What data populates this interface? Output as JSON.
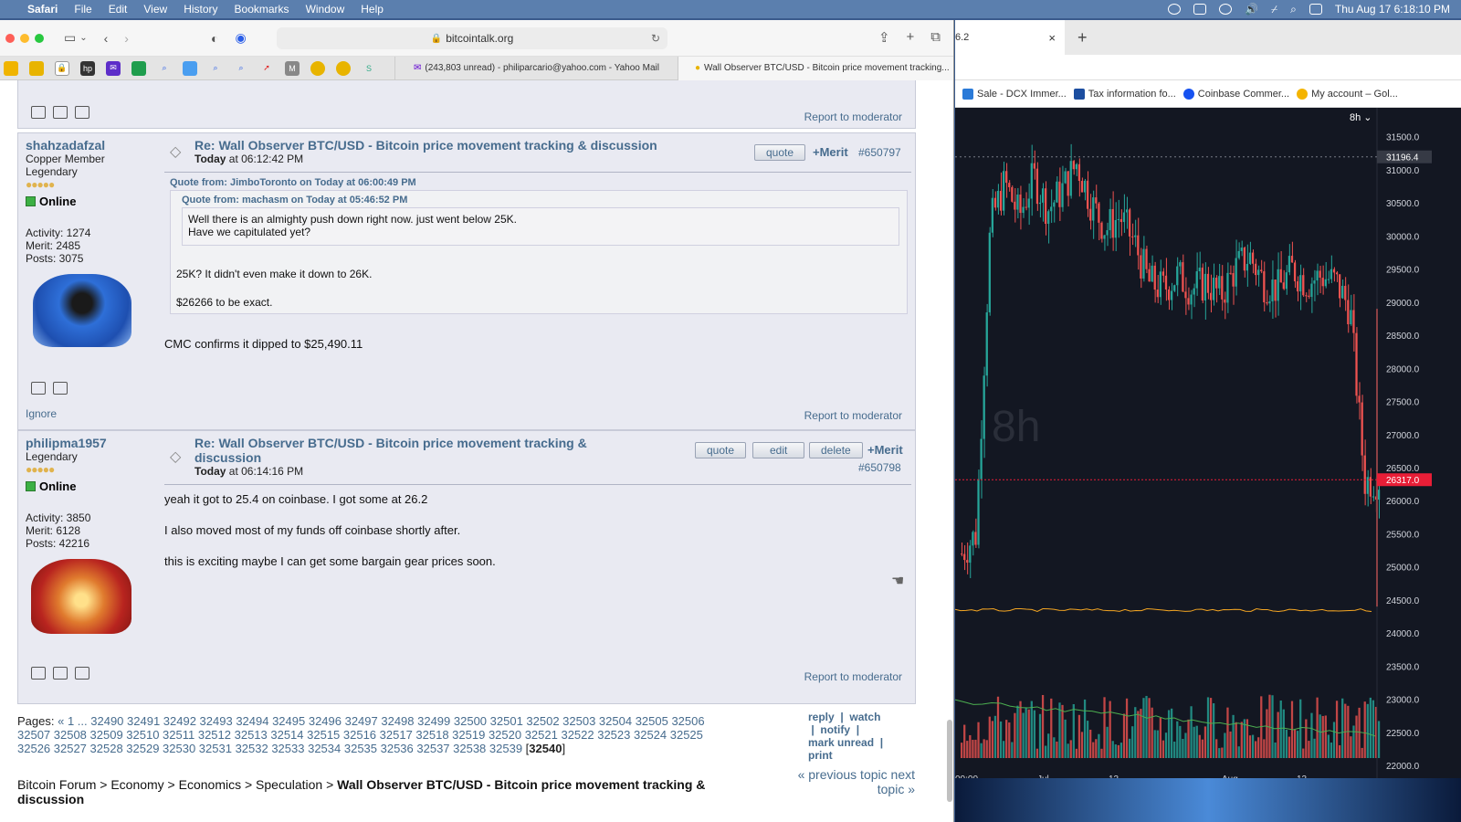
{
  "menubar": {
    "app": "Safari",
    "items": [
      "File",
      "Edit",
      "View",
      "History",
      "Bookmarks",
      "Window",
      "Help"
    ],
    "clock": "Thu Aug 17  6:18:10 PM"
  },
  "safari": {
    "url": "bitcointalk.org",
    "tabs": [
      {
        "title": "(243,803 unread) - philiparcario@yahoo.com - Yahoo Mail"
      },
      {
        "title": "Wall Observer BTC/USD - Bitcoin price movement tracking..."
      }
    ]
  },
  "chart_window": {
    "tab_title": "6.2",
    "bookmarks": [
      "Sale - DCX Immer...",
      "Tax information fo...",
      "Coinbase Commer...",
      "My account – Gol..."
    ],
    "interval": "8h",
    "watermark": "8h",
    "price_labels": [
      "31500.0",
      "31000.0",
      "30500.0",
      "30000.0",
      "29500.0",
      "29000.0",
      "28500.0",
      "28000.0",
      "27500.0",
      "27000.0",
      "26500.0",
      "26000.0",
      "25500.0",
      "25000.0",
      "24500.0",
      "24000.0",
      "23500.0",
      "23000.0",
      "22500.0",
      "22000.0"
    ],
    "price_top": "31196.4",
    "price_current": "26317.0",
    "time_labels": [
      "00:00",
      "Jul",
      "13",
      "Aug",
      "13"
    ],
    "colors": {
      "up": "#26a69a",
      "down": "#ef5350",
      "bg": "#131722",
      "current": "#e91e37"
    }
  },
  "chart_data": {
    "type": "candlestick",
    "title": "",
    "ylim": [
      22000,
      31800
    ],
    "x_labels": [
      "00:00",
      "Jul",
      "13",
      "Aug",
      "13"
    ],
    "close_path": [
      25200,
      25500,
      30200,
      30800,
      30300,
      30900,
      30400,
      30700,
      31100,
      30500,
      30100,
      30300,
      29900,
      29300,
      29200,
      29400,
      29200,
      29300,
      29100,
      29500,
      29700,
      29300,
      29200,
      29500,
      29300,
      29400,
      29300,
      28900,
      26300,
      26317
    ]
  },
  "forum": {
    "top_report": "Report to moderator",
    "post1": {
      "username": "shahzadafzal",
      "rank": "Copper Member",
      "rank2": "Legendary",
      "status": "Online",
      "activity": "Activity: 1274",
      "merit": "Merit: 2485",
      "posts": "Posts: 3075",
      "title": "Re: Wall Observer BTC/USD - Bitcoin price movement tracking & discussion",
      "time_bold": "Today",
      "time": " at 06:12:42 PM",
      "quote_btn": "quote",
      "merit_btn": "+Merit",
      "msg_id": "#650797",
      "quote1_head": "Quote from: JimboToronto on Today at 06:00:49 PM",
      "quote2_head": "Quote from: machasm on Today at 05:46:52 PM",
      "quote2_line1": "Well there is an almighty push down right now. just went below 25K.",
      "quote2_line2": "Have we capitulated yet?",
      "quote1_line1": "25K?  It didn't even make it down to 26K.",
      "quote1_line2": "$26266 to be exact.",
      "body": "CMC confirms it dipped to $25,490.11",
      "ignore": "Ignore",
      "report": "Report to moderator"
    },
    "post2": {
      "username": "philipma1957",
      "rank": "Legendary",
      "status": "Online",
      "activity": "Activity: 3850",
      "merit": "Merit: 6128",
      "posts": "Posts: 42216",
      "title_line1": "Re: Wall Observer BTC/USD - Bitcoin price movement tracking &",
      "title_line2": "discussion",
      "time_bold": "Today",
      "time": " at 06:14:16 PM",
      "quote_btn": "quote",
      "edit_btn": "edit",
      "delete_btn": "delete",
      "merit_btn": "+Merit",
      "msg_id": "#650798",
      "line1": "yeah it got to 25.4 on coinbase.  I got some at 26.2",
      "line2": "I also moved most of my funds off coinbase shortly after.",
      "line3": "this is exciting maybe I can get some bargain gear prices soon.",
      "report": "Report to moderator"
    },
    "pages_label": "Pages:",
    "pages_prefix": "« 1 ...",
    "pages_line1": "32490 32491 32492 32493 32494 32495 32496 32497 32498 32499 32500 32501 32502 32503 32504 32505 32506",
    "pages_line2": "32507 32508 32509 32510 32511 32512 32513 32514 32515 32516 32517 32518 32519 32520 32521 32522 32523 32524 32525",
    "pages_line3": "32526 32527 32528 32529 32530 32531 32532 32533 32534 32535 32536 32537 32538 32539",
    "current_page": "32540",
    "actions": {
      "reply": "reply",
      "watch": "watch",
      "notify": "notify",
      "mark_unread": "mark unread",
      "print": "print"
    },
    "breadcrumb_plain": "Bitcoin Forum > Economy > Economics > Speculation > ",
    "breadcrumb_bold": "Wall Observer BTC/USD - Bitcoin price movement tracking & discussion",
    "prev_topic": "« previous topic",
    "next_topic": "next topic »"
  }
}
